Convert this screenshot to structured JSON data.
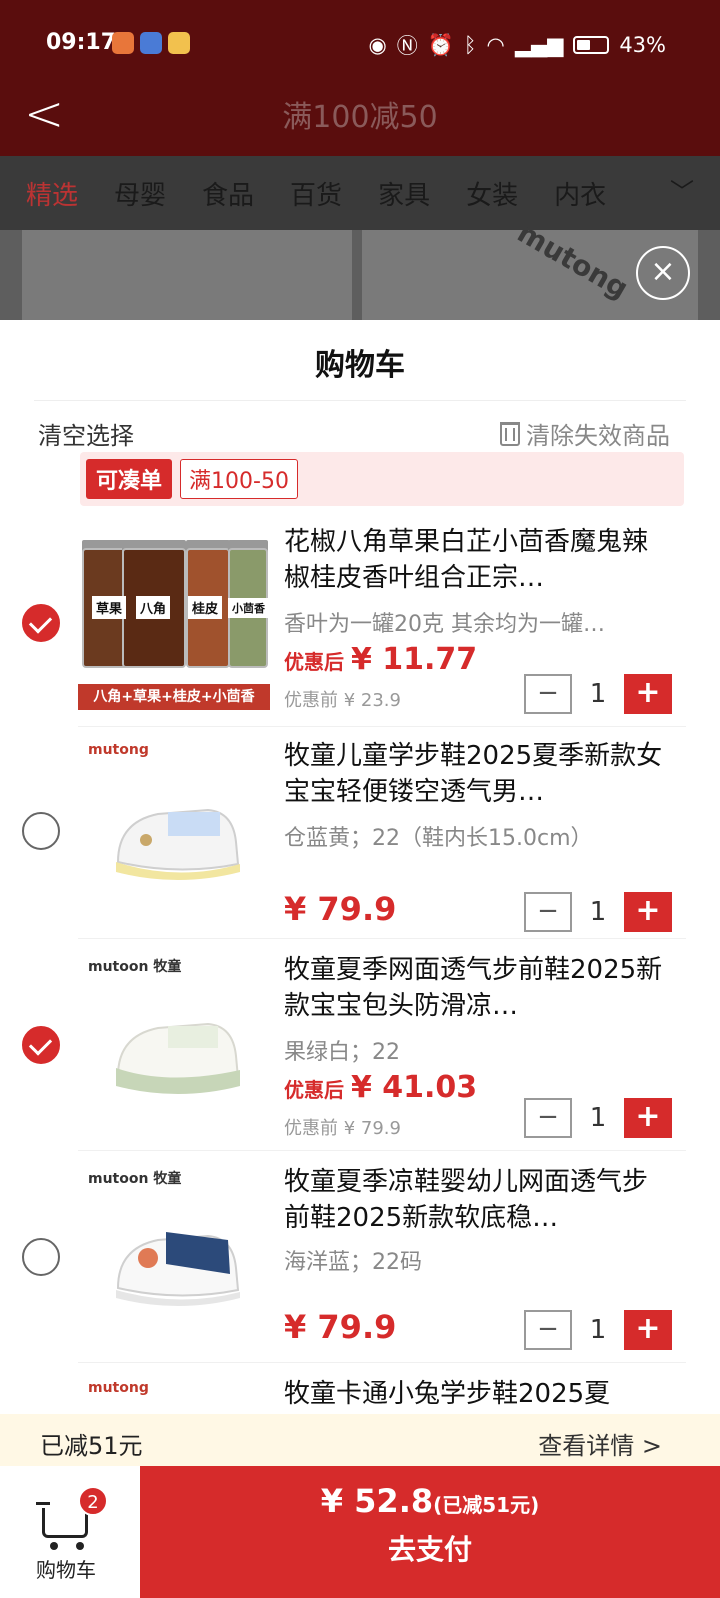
{
  "status": {
    "time": "09:17",
    "icons": [
      "eye-icon",
      "nfc-icon",
      "alarm-icon",
      "bluetooth-icon",
      "wifi-icon",
      "5g-signal-icon",
      "battery-icon"
    ],
    "battery_percent": "43%"
  },
  "header": {
    "title": "满100减50"
  },
  "category_tabs": [
    "精选",
    "母婴",
    "食品",
    "百货",
    "家具",
    "女装",
    "内衣"
  ],
  "cart_sheet": {
    "title": "购物车",
    "clear_selection": "清空选择",
    "clear_invalid": "清除失效商品",
    "promo_tag": "可凑单",
    "promo_rule": "满100-50",
    "items": [
      {
        "checked": true,
        "brand": "",
        "thumb_strip": "八角+草果+桂皮+小茴香",
        "jar_labels": [
          "草果",
          "八角",
          "桂皮",
          "小茴香"
        ],
        "title": "花椒八角草果白芷小茴香魔鬼辣椒桂皮香叶组合正宗…",
        "variant": "香叶为一罐20克 其余均为一罐…",
        "price_after_label": "优惠后",
        "price_after": "¥ 11.77",
        "price_before": "优惠前 ¥ 23.9",
        "quantity": "1"
      },
      {
        "checked": false,
        "brand": "mutong",
        "title": "牧童儿童学步鞋2025夏季新款女宝宝轻便镂空透气男…",
        "variant": "仓蓝黄；22（鞋内长15.0cm）",
        "price": "¥ 79.9",
        "quantity": "1"
      },
      {
        "checked": true,
        "brand": "mutoon 牧童",
        "title": "牧童夏季网面透气步前鞋2025新款宝宝包头防滑凉…",
        "variant": "果绿白；22",
        "price_after_label": "优惠后",
        "price_after": "¥ 41.03",
        "price_before": "优惠前 ¥ 79.9",
        "quantity": "1"
      },
      {
        "checked": false,
        "brand": "mutoon 牧童",
        "title": "牧童夏季凉鞋婴幼儿网面透气步前鞋2025新款软底稳…",
        "variant": "海洋蓝；22码",
        "price": "¥ 79.9",
        "quantity": "1"
      },
      {
        "checked": false,
        "brand": "mutong",
        "title": "牧童卡通小兔学步鞋2025夏"
      }
    ]
  },
  "savings_bar": {
    "left": "已减51元",
    "right": "查看详情 >"
  },
  "bottom_bar": {
    "cart_label": "购物车",
    "cart_count": "2",
    "total": "¥ 52.8",
    "total_note": "(已减51元)",
    "pay_label": "去支付"
  },
  "colors": {
    "accent": "#d62b2b",
    "header_bg": "#5a0d0d",
    "promo_bg": "#fde9e9",
    "savings_bg": "#fff8e5"
  }
}
